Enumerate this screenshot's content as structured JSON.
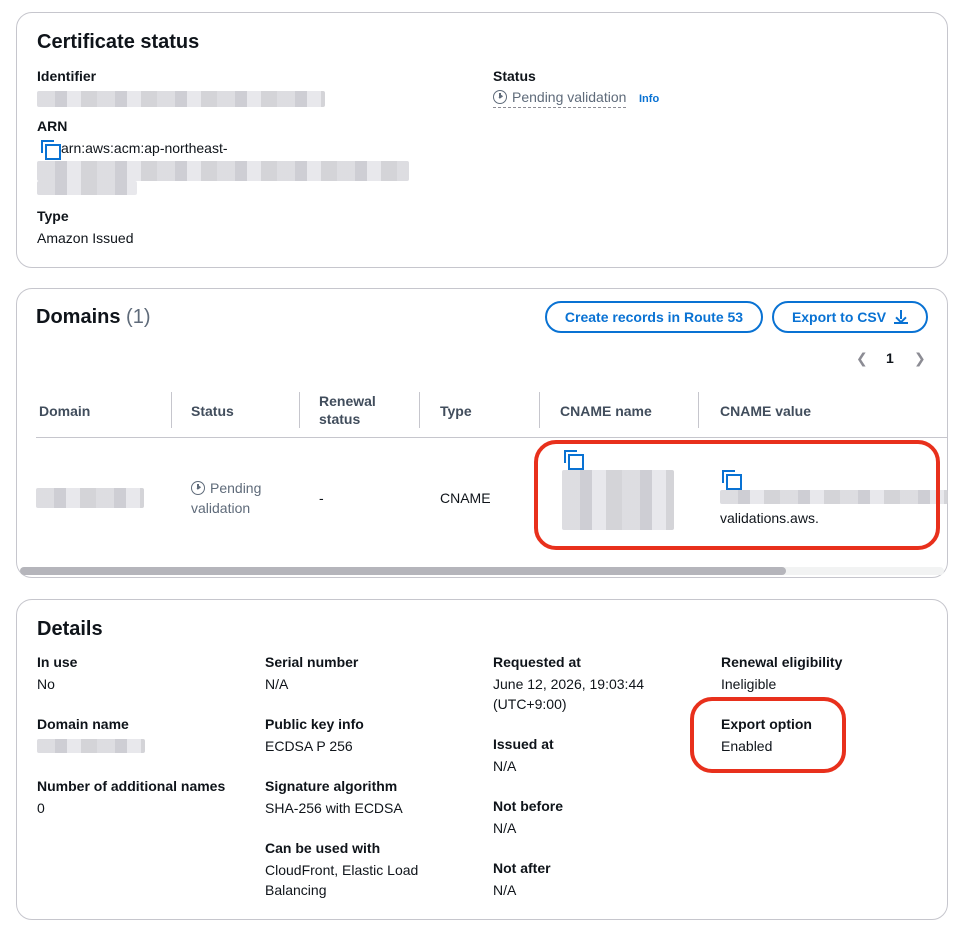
{
  "certificate_status": {
    "title": "Certificate status",
    "identifier_label": "Identifier",
    "arn_label": "ARN",
    "arn_prefix": "arn:aws:acm:ap-northeast-",
    "type_label": "Type",
    "type_value": "Amazon Issued",
    "status_label": "Status",
    "status_value": "Pending validation",
    "info_link": "Info"
  },
  "domains": {
    "title": "Domains",
    "count": "(1)",
    "create_records_button": "Create records in Route 53",
    "export_button": "Export to CSV",
    "page_number": "1",
    "columns": [
      "Domain",
      "Status",
      "Renewal status",
      "Type",
      "CNAME name",
      "CNAME value"
    ],
    "rows": [
      {
        "status": "Pending validation",
        "renewal_status": "-",
        "type": "CNAME",
        "cname_value_suffix": "validations.aws."
      }
    ]
  },
  "details": {
    "title": "Details",
    "in_use_label": "In use",
    "in_use_value": "No",
    "domain_name_label": "Domain name",
    "additional_names_label": "Number of additional names",
    "additional_names_value": "0",
    "serial_number_label": "Serial number",
    "serial_number_value": "N/A",
    "public_key_label": "Public key info",
    "public_key_value": "ECDSA P 256",
    "signature_label": "Signature algorithm",
    "signature_value": "SHA-256 with ECDSA",
    "can_be_used_label": "Can be used with",
    "can_be_used_value": "CloudFront, Elastic Load Balancing",
    "requested_at_label": "Requested at",
    "requested_at_value": "June 12, 2026, 19:03:44 (UTC+9:00)",
    "issued_at_label": "Issued at",
    "issued_at_value": "N/A",
    "not_before_label": "Not before",
    "not_before_value": "N/A",
    "not_after_label": "Not after",
    "not_after_value": "N/A",
    "renewal_label": "Renewal eligibility",
    "renewal_value": "Ineligible",
    "export_option_label": "Export option",
    "export_option_value": "Enabled"
  },
  "colors": {
    "link": "#0972d3",
    "highlight": "#e8301c",
    "border": "#c6c6cd"
  }
}
